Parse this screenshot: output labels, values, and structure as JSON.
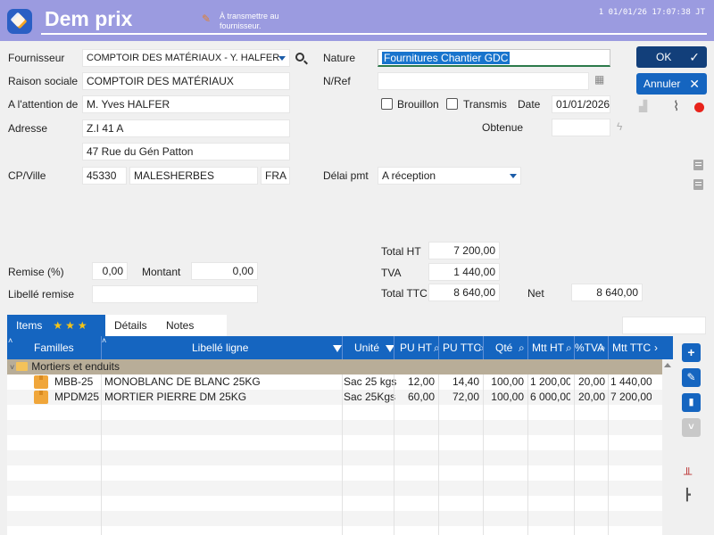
{
  "header": {
    "title": "Dem prix",
    "status": "À transmettre au fournisseur.",
    "info": "1  01/01/26 17:07:38  JT"
  },
  "form": {
    "fournisseur": {
      "label": "Fournisseur",
      "value": "COMPTOIR DES MATÉRIAUX - Y. HALFER"
    },
    "raison_sociale": {
      "label": "Raison sociale",
      "value": "COMPTOIR DES MATÉRIAUX"
    },
    "attention": {
      "label": "A l'attention de",
      "value": "M. Yves HALFER"
    },
    "adresse": {
      "label": "Adresse",
      "line1": "Z.I 41 A",
      "line2": "47 Rue du Gén Patton"
    },
    "cp_ville": {
      "label": "CP/Ville",
      "cp": "45330",
      "ville": "MALESHERBES",
      "pays": "FRA"
    },
    "nature": {
      "label": "Nature",
      "value": "Fournitures Chantier GDC"
    },
    "nref": {
      "label": "N/Ref",
      "value": ""
    },
    "brouillon": {
      "label": "Brouillon",
      "checked": false
    },
    "transmis": {
      "label": "Transmis",
      "checked": false
    },
    "date": {
      "label": "Date",
      "value": "01/01/2026"
    },
    "obtenue": {
      "label": "Obtenue",
      "value": ""
    },
    "delai": {
      "label": "Délai pmt",
      "value": "A réception"
    }
  },
  "buttons": {
    "ok": "OK",
    "annuler": "Annuler"
  },
  "totals": {
    "total_ht": {
      "label": "Total HT",
      "value": "7 200,00"
    },
    "tva": {
      "label": "TVA",
      "value": "1 440,00"
    },
    "total_ttc": {
      "label": "Total TTC",
      "value": "8 640,00"
    },
    "net": {
      "label": "Net",
      "value": "8 640,00"
    }
  },
  "remise": {
    "pct_label": "Remise (%)",
    "pct_value": "0,00",
    "montant_label": "Montant",
    "montant_value": "0,00",
    "libelle_label": "Libellé remise",
    "libelle_value": ""
  },
  "tabs": [
    {
      "label": "Items",
      "active": true
    },
    {
      "label": "Détails",
      "active": false
    },
    {
      "label": "Notes",
      "active": false
    }
  ],
  "table": {
    "columns": [
      "Familles",
      "Libellé ligne",
      "Unité",
      "PU HT",
      "PU TTC",
      "Qté",
      "Mtt HT",
      "%TVA",
      "Mtt TTC"
    ],
    "group": "Mortiers et enduits",
    "rows": [
      {
        "code": "MBB-25",
        "libelle": "MONOBLANC DE BLANC 25KG",
        "unite": "Sac 25 kgs",
        "pu_ht": "12,00",
        "pu_ttc": "14,40",
        "qte": "100,00",
        "mtt_ht": "1 200,00",
        "tva": "20,00",
        "mtt_ttc": "1 440,00"
      },
      {
        "code": "MPDM25",
        "libelle": "MORTIER PIERRE DM 25KG",
        "unite": "Sac 25Kgs",
        "pu_ht": "60,00",
        "pu_ttc": "72,00",
        "qte": "100,00",
        "mtt_ht": "6 000,00",
        "tva": "20,00",
        "mtt_ttc": "7 200,00"
      }
    ]
  },
  "colors": {
    "header": "#9b9be0",
    "accent": "#1565c0",
    "ok_button": "#123f7a",
    "group_row": "#b8ad98"
  }
}
